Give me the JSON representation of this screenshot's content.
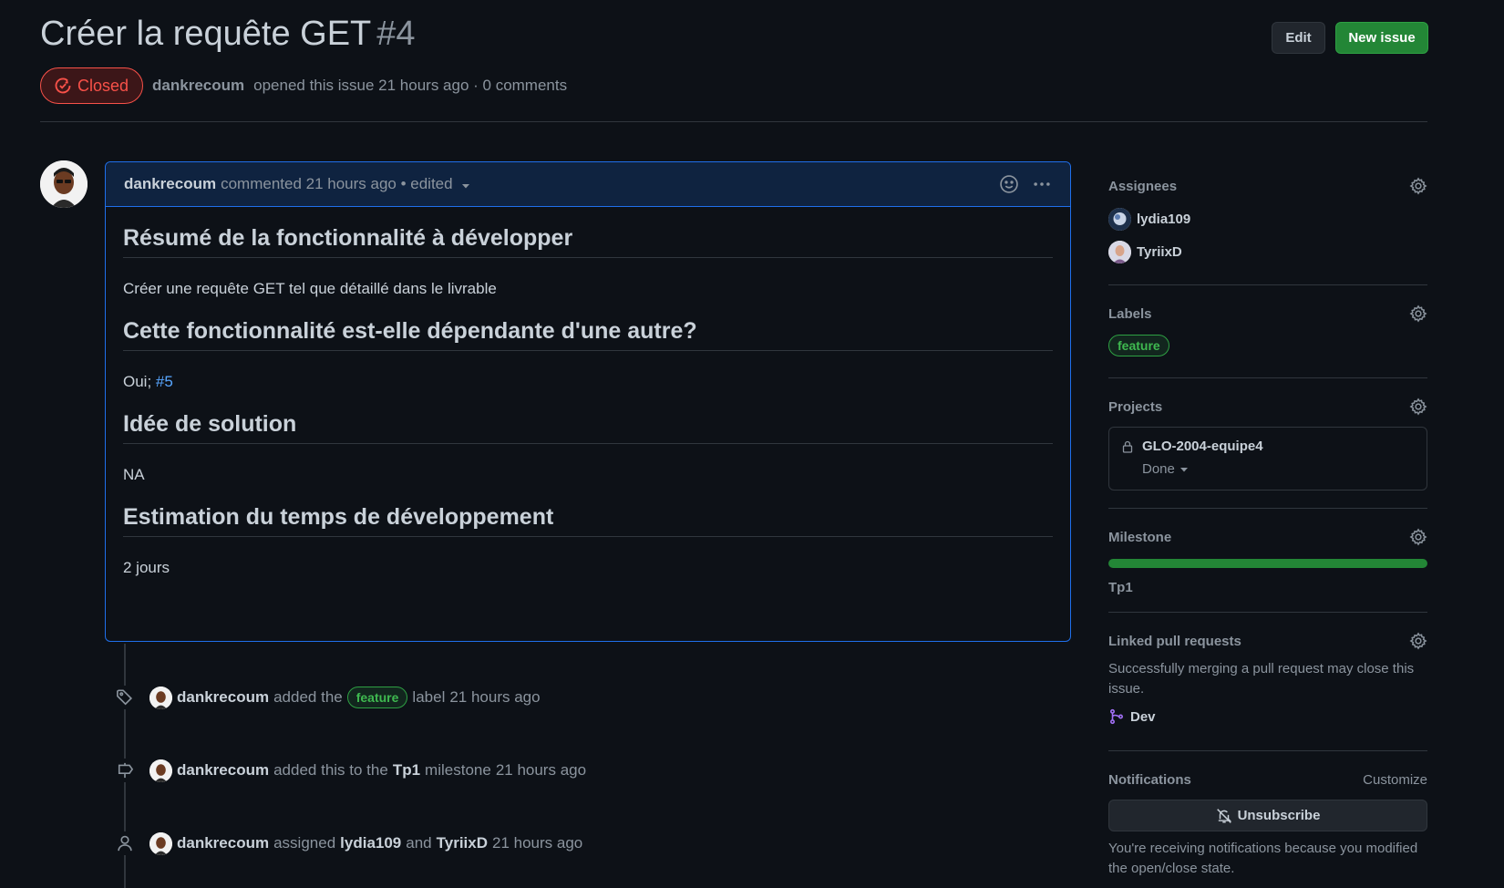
{
  "header": {
    "title": "Créer la requête GET",
    "number": "#4",
    "edit_label": "Edit",
    "new_issue_label": "New issue"
  },
  "meta": {
    "state": "Closed",
    "author": "dankrecoum",
    "text": "opened this issue 21 hours ago · 0 comments"
  },
  "comment": {
    "author": "dankrecoum",
    "meta": "commented 21 hours ago • edited",
    "sections": [
      {
        "heading": "Résumé de la fonctionnalité à développer",
        "body": "Créer une requête GET tel que détaillé dans le livrable"
      },
      {
        "heading": "Cette fonctionnalité est-elle dépendante d'une autre?",
        "body_prefix": "Oui; ",
        "body_link": "#5"
      },
      {
        "heading": "Idée de solution",
        "body": "NA"
      },
      {
        "heading": "Estimation du temps de développement",
        "body": "2 jours"
      }
    ]
  },
  "timeline": [
    {
      "icon": "tag-icon",
      "user": "dankrecoum",
      "text1": "added the",
      "label": "feature",
      "text2": "label",
      "when": "21 hours ago"
    },
    {
      "icon": "milestone-icon",
      "user": "dankrecoum",
      "text1": "added this to the",
      "strong": "Tp1",
      "text2": "milestone",
      "when": "21 hours ago"
    },
    {
      "icon": "person-icon",
      "user": "dankrecoum",
      "text1": "assigned",
      "strong": "lydia109",
      "text2": "and",
      "strong2": "TyriixD",
      "when": "21 hours ago"
    }
  ],
  "sidebar": {
    "assignees": {
      "title": "Assignees",
      "people": [
        "lydia109",
        "TyriixD"
      ]
    },
    "labels": {
      "title": "Labels",
      "items": [
        "feature"
      ]
    },
    "projects": {
      "title": "Projects",
      "name": "GLO-2004-equipe4",
      "status": "Done"
    },
    "milestone": {
      "title": "Milestone",
      "name": "Tp1",
      "progress": 1.0
    },
    "linked_prs": {
      "title": "Linked pull requests",
      "text": "Successfully merging a pull request may close this issue.",
      "branch": "Dev"
    },
    "notifications": {
      "title": "Notifications",
      "customize": "Customize",
      "button": "Unsubscribe",
      "text": "You're receiving notifications because you modified the open/close state."
    }
  },
  "colors": {
    "background": "#0d1117",
    "closed_red": "#f85149",
    "accent_blue": "#1f6feb",
    "green": "#238636",
    "label_green": "#3fb950"
  }
}
